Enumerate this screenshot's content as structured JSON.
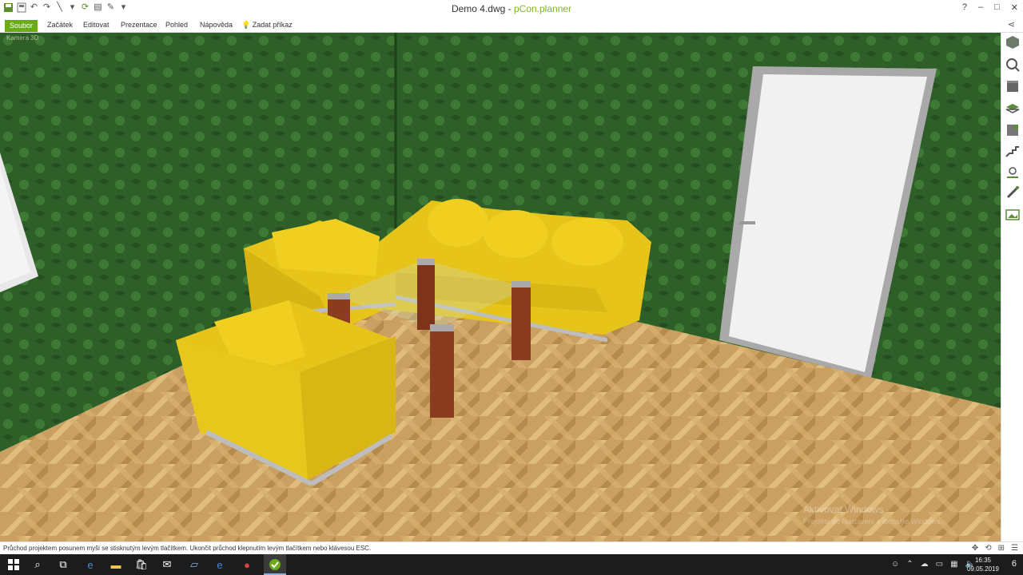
{
  "window": {
    "doc_title": "Demo 4.dwg",
    "separator": " - ",
    "app_name": "pCon.planner",
    "help": "?",
    "minimize": "–",
    "maximize": "□",
    "close": "✕"
  },
  "ribbon": {
    "tabs": [
      "Soubor",
      "Začátek",
      "Editovat",
      "Prezentace",
      "Pohled",
      "Nápověda"
    ],
    "active_tab": "Soubor",
    "command_label": "Zadat příkaz"
  },
  "viewport": {
    "view_label": "Kamera 3D",
    "watermark_title": "Aktivovat Windows",
    "watermark_sub": "Přejděte do Nastavení a aktivujte Windows."
  },
  "status": {
    "message": "Průchod projektem posunem myši se stisknutým levým tlačítkem. Ukončit průchod klepnutím levým tlačítkem nebo klávesou ESC."
  },
  "taskbar": {
    "time": "16:35",
    "date": "09.05.2019",
    "notification_count": "6"
  },
  "colors": {
    "accent": "#6aab17",
    "wall": "#2f5f28",
    "sofa": "#e6c41a",
    "floor": "#c9a061"
  }
}
